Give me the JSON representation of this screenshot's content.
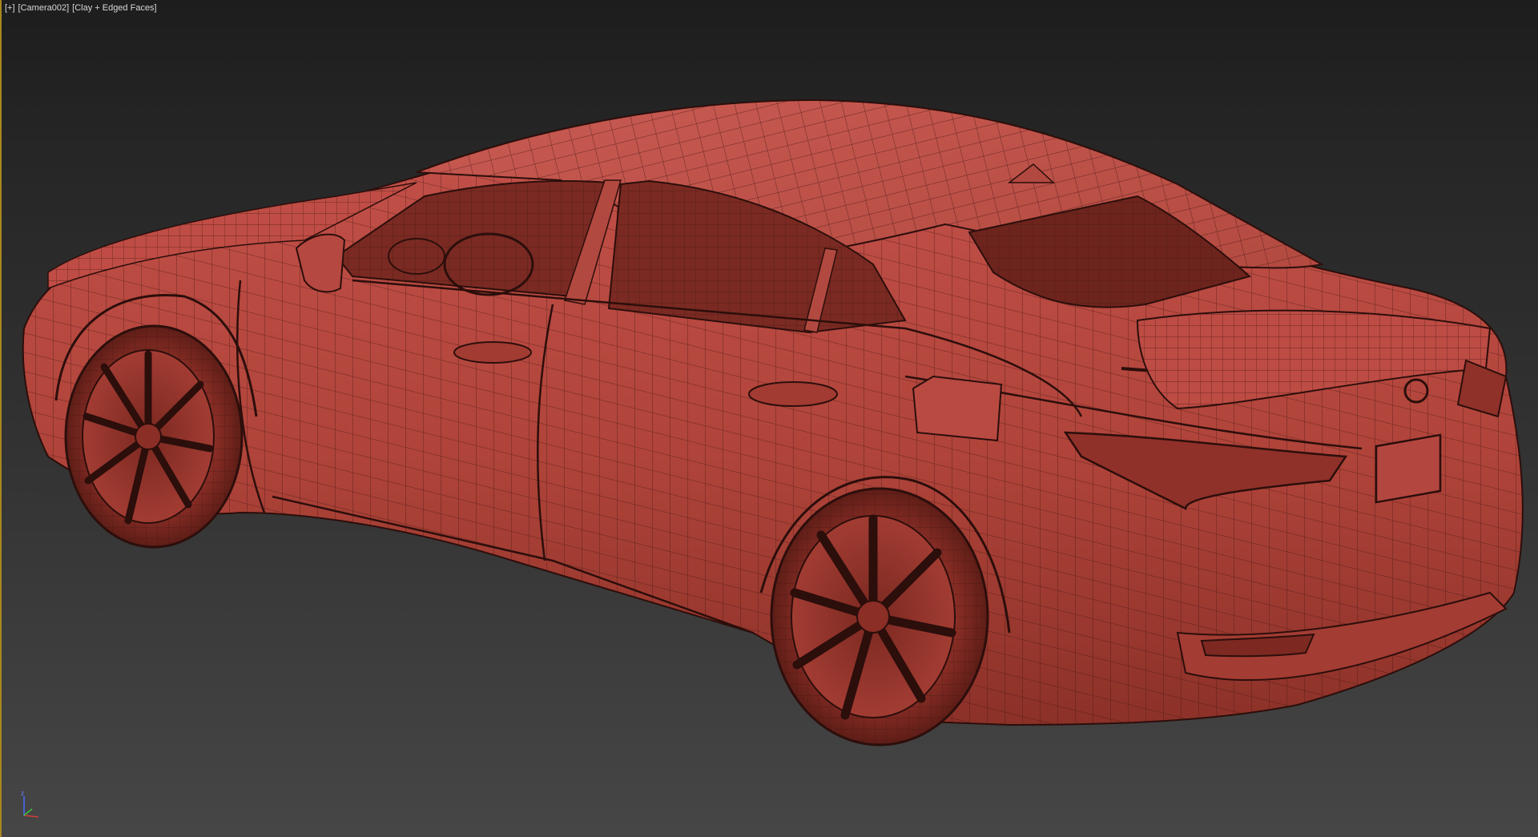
{
  "viewport": {
    "label": {
      "plus_menu": "[+]",
      "camera": "[Camera002]",
      "shading": "[Clay + Edged Faces]"
    },
    "background_colors": [
      "#1d1d1d",
      "#464646"
    ],
    "active_border_color": "#a8871f",
    "model": {
      "name": "sedan-car-model",
      "clay_color": "#b8463c",
      "wire_color": "#3a1410"
    },
    "axis_gizmo": {
      "z_label": "z",
      "colors": {
        "x": "#d23c3c",
        "y": "#3cc83c",
        "z": "#4a6cff"
      }
    }
  }
}
